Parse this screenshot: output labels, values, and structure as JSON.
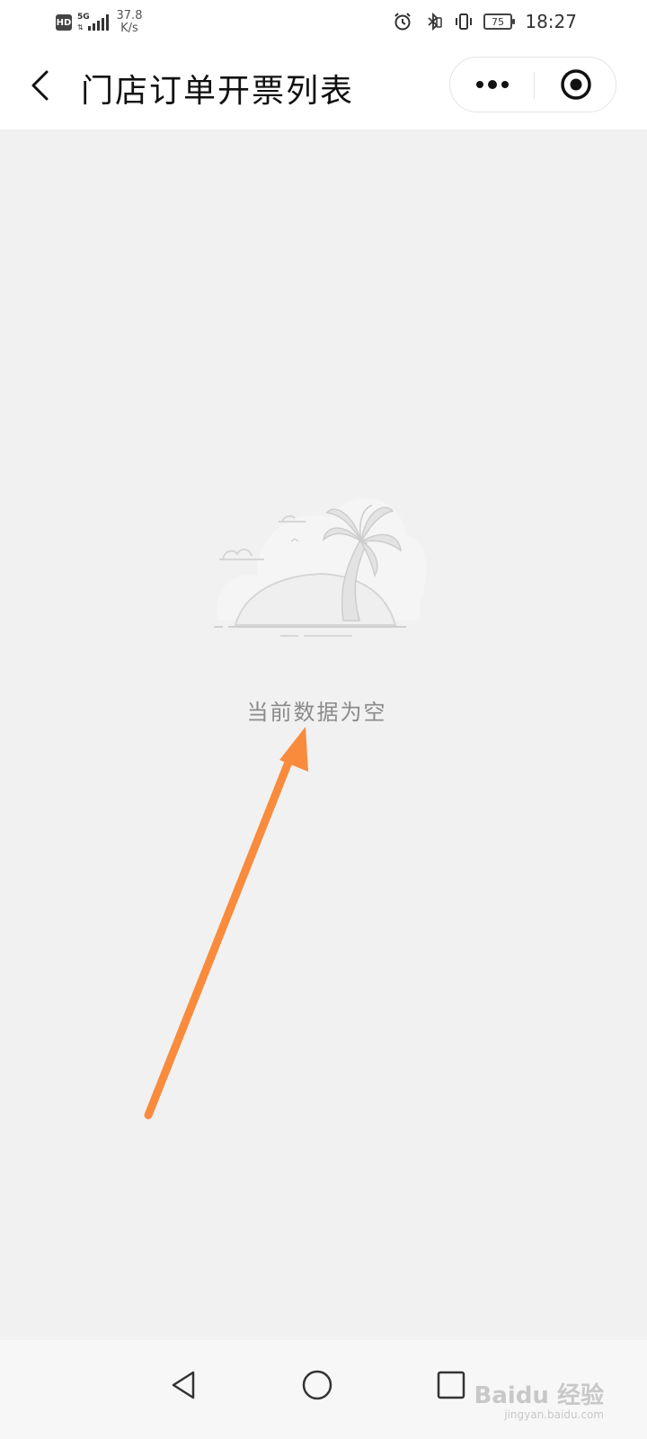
{
  "status_bar": {
    "hd": "HD",
    "network": "5G",
    "speed_value": "37.8",
    "speed_unit": "K/s",
    "battery": "75",
    "time": "18:27"
  },
  "header": {
    "title": "门店订单开票列表"
  },
  "main": {
    "empty_message": "当前数据为空"
  },
  "watermark": {
    "logo": "Baidu 经验",
    "url": "jingyan.baidu.com"
  },
  "colors": {
    "page_background": "#f1f1f1",
    "header_background": "#ffffff",
    "empty_text": "#8a8a8a",
    "annotation_arrow": "#f98b3c"
  },
  "icons": {
    "back": "chevron-left-icon",
    "more": "more-dots-icon",
    "close": "target-circle-icon",
    "sys_back": "triangle-back-icon",
    "sys_home": "circle-home-icon",
    "sys_recent": "square-recent-icon"
  }
}
